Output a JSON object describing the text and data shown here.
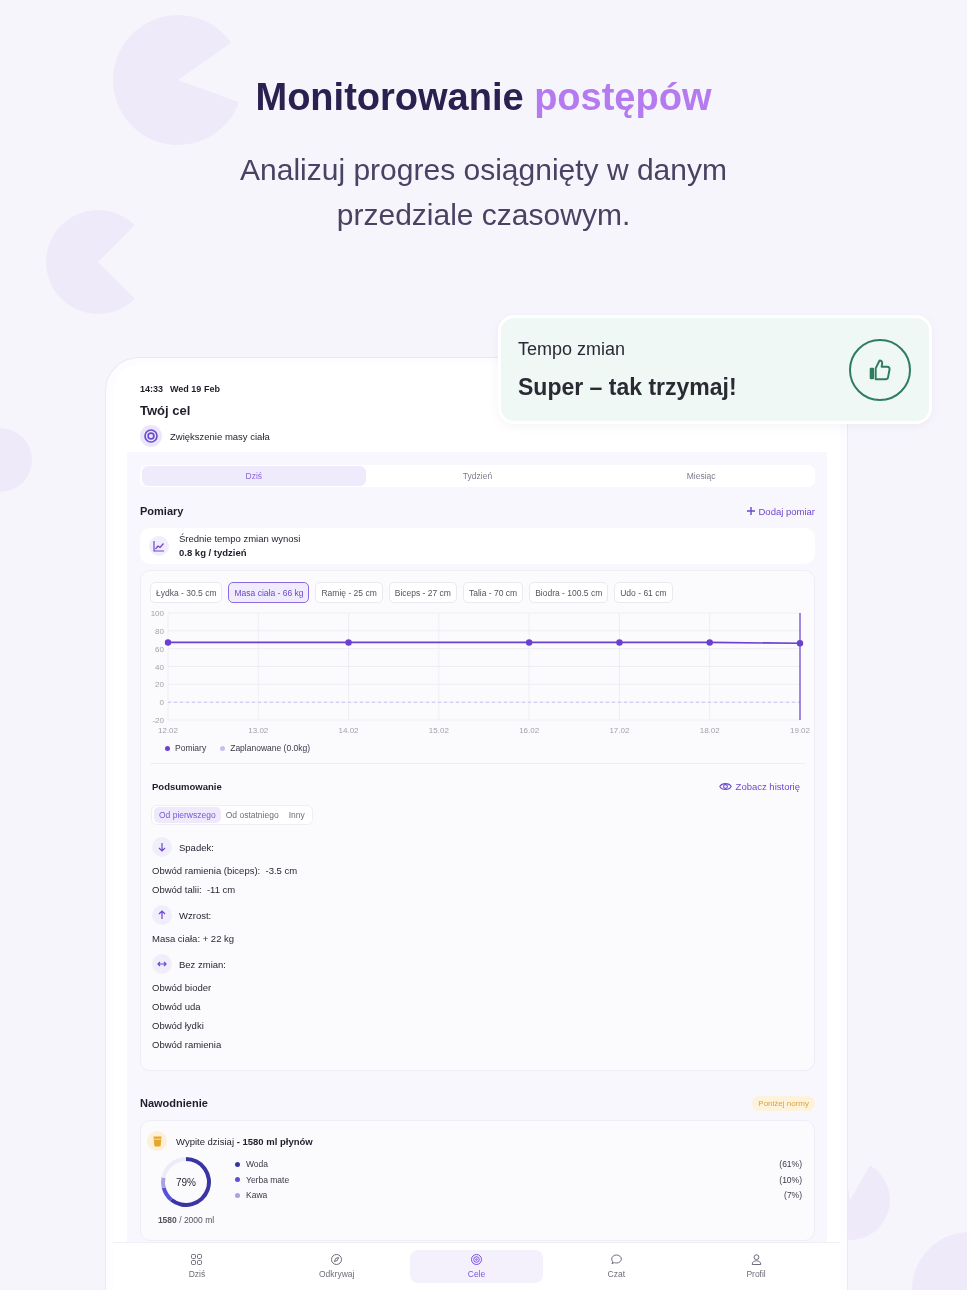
{
  "hero": {
    "title": "Monitorowanie",
    "title_accent": "postępów",
    "subtitle": "Analizuj progres osiągnięty w danym przedziale czasowym."
  },
  "tempo_card": {
    "label": "Tempo zmian",
    "message": "Super – tak trzymaj!"
  },
  "status_bar": {
    "time": "14:33",
    "date": "Wed 19 Feb"
  },
  "goal": {
    "title": "Twój cel",
    "name": "Zwiększenie masy ciała"
  },
  "period_tabs": [
    {
      "label": "Dziś",
      "selected": true
    },
    {
      "label": "Tydzień",
      "selected": false
    },
    {
      "label": "Miesiąc",
      "selected": false
    }
  ],
  "measurements": {
    "title": "Pomiary",
    "add_button": "Dodaj pomiar",
    "average": {
      "label": "Średnie tempo zmian wynosi",
      "value": "0.8 kg / tydzień"
    },
    "chips": [
      {
        "label": "Łydka - 30.5 cm",
        "selected": false
      },
      {
        "label": "Masa ciała - 66 kg",
        "selected": true
      },
      {
        "label": "Ramię - 25 cm",
        "selected": false
      },
      {
        "label": "Biceps - 27 cm",
        "selected": false
      },
      {
        "label": "Talia - 70 cm",
        "selected": false
      },
      {
        "label": "Biodra - 100.5 cm",
        "selected": false
      },
      {
        "label": "Udo - 61 cm",
        "selected": false
      }
    ],
    "chart_data": {
      "type": "line",
      "grid": true,
      "categories": [
        "12.02",
        "13.02",
        "14.02",
        "15.02",
        "16.02",
        "17.02",
        "18.02",
        "19.02"
      ],
      "ylim": [
        -20,
        100
      ],
      "yticks": [
        -20,
        0,
        20,
        40,
        60,
        80,
        100
      ],
      "series": [
        {
          "name": "Pomiary",
          "color": "#6b3fd0",
          "marker": "circle",
          "line_style": "solid",
          "values": [
            67,
            null,
            67,
            null,
            67,
            67,
            67,
            66
          ]
        },
        {
          "name": "Zaplanowane (0.0kg)",
          "color": "#cbbdf0",
          "line_style": "dashed",
          "values": [
            0,
            0,
            0,
            0,
            0,
            0,
            0,
            0
          ]
        }
      ]
    },
    "summary": {
      "title": "Podsumowanie",
      "history_link": "Zobacz historię",
      "tabs": [
        {
          "label": "Od pierwszego",
          "selected": true
        },
        {
          "label": "Od ostatniego",
          "selected": false
        },
        {
          "label": "Inny",
          "selected": false
        }
      ],
      "groups": [
        {
          "kind": "down",
          "title": "Spadek:",
          "items": [
            "Obwód ramienia (biceps):  -3.5 cm",
            "Obwód talii:  -11 cm"
          ]
        },
        {
          "kind": "up",
          "title": "Wzrost:",
          "items": [
            "Masa ciała: + 22 kg"
          ]
        },
        {
          "kind": "same",
          "title": "Bez zmian:",
          "items": [
            "Obwód bioder",
            "Obwód uda",
            "Obwód łydki",
            "Obwód ramienia"
          ]
        }
      ]
    }
  },
  "hydration": {
    "title": "Nawodnienie",
    "badge": "Poniżej normy",
    "summary": "Wypite dzisiaj **- 1580 ml płynów**",
    "percent": "79%",
    "amount": "**1580** / 2000 ml",
    "chart_data": {
      "type": "donut",
      "categories": [
        "Woda",
        "Yerba mate",
        "Kawa",
        null
      ],
      "values": [
        61,
        10,
        7,
        22
      ],
      "colors": [
        "#3b35a3",
        "#5a51d8",
        "#a8a2e2",
        "#ecebf7"
      ],
      "value_labels": [
        "(61%)",
        "(10%)",
        "(7%)",
        null
      ]
    }
  },
  "bottom_nav": [
    {
      "label": "Dziś",
      "kind": "grid",
      "selected": false
    },
    {
      "label": "Odkrywaj",
      "kind": "compass",
      "selected": false
    },
    {
      "label": "Cele",
      "kind": "target",
      "selected": true
    },
    {
      "label": "Czat",
      "kind": "chat",
      "selected": false
    },
    {
      "label": "Profil",
      "kind": "person",
      "selected": false
    }
  ]
}
